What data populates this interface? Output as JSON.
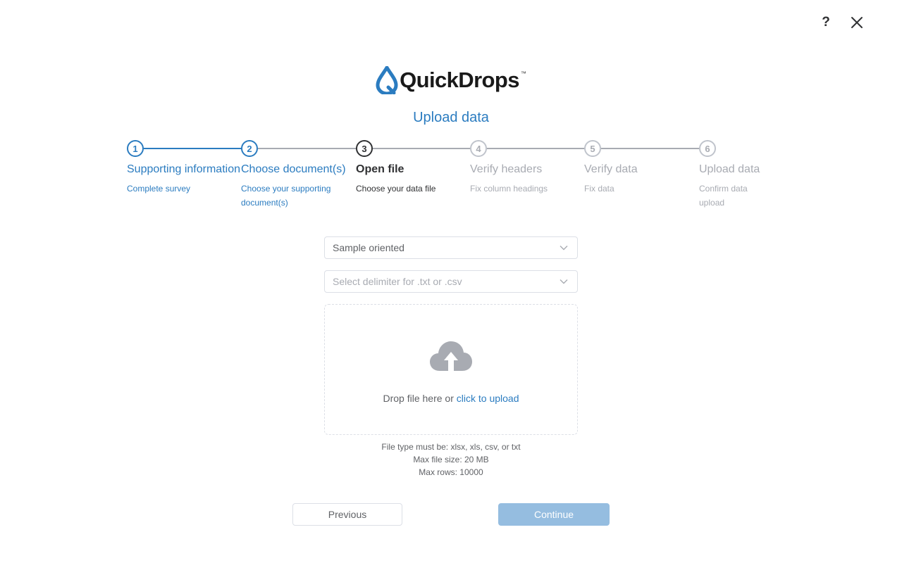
{
  "header": {
    "help_icon": "question-mark-icon",
    "close_icon": "close-icon",
    "help_label": "?"
  },
  "logo": {
    "text": "QuickDrops",
    "tm": "™",
    "brand_color": "#2b7cc0"
  },
  "page": {
    "title": "Upload data"
  },
  "steps": [
    {
      "number": "1",
      "title": "Supporting information",
      "desc": "Complete survey",
      "state": "done"
    },
    {
      "number": "2",
      "title": "Choose document(s)",
      "desc": "Choose your supporting document(s)",
      "state": "done"
    },
    {
      "number": "3",
      "title": "Open file",
      "desc": "Choose your data file",
      "state": "active"
    },
    {
      "number": "4",
      "title": "Verify headers",
      "desc": "Fix column headings",
      "state": "pending"
    },
    {
      "number": "5",
      "title": "Verify data",
      "desc": "Fix data",
      "state": "pending"
    },
    {
      "number": "6",
      "title": "Upload data",
      "desc": "Confirm data upload",
      "state": "pending"
    }
  ],
  "form": {
    "orientation_value": "Sample oriented",
    "delimiter_placeholder": "Select delimiter for .txt or .csv"
  },
  "upload": {
    "icon": "cloud-upload-icon",
    "drop_text": "Drop file here or ",
    "link_text": "click to upload"
  },
  "file_info": {
    "types": "File type must be: xlsx, xls, csv, or txt",
    "max_size": "Max file size: 20 MB",
    "max_rows": "Max rows: 10000"
  },
  "buttons": {
    "previous": "Previous",
    "continue": "Continue"
  },
  "colors": {
    "accent": "#2b7cc0",
    "continue_disabled": "#95bde0",
    "pending": "#a8abb2"
  }
}
